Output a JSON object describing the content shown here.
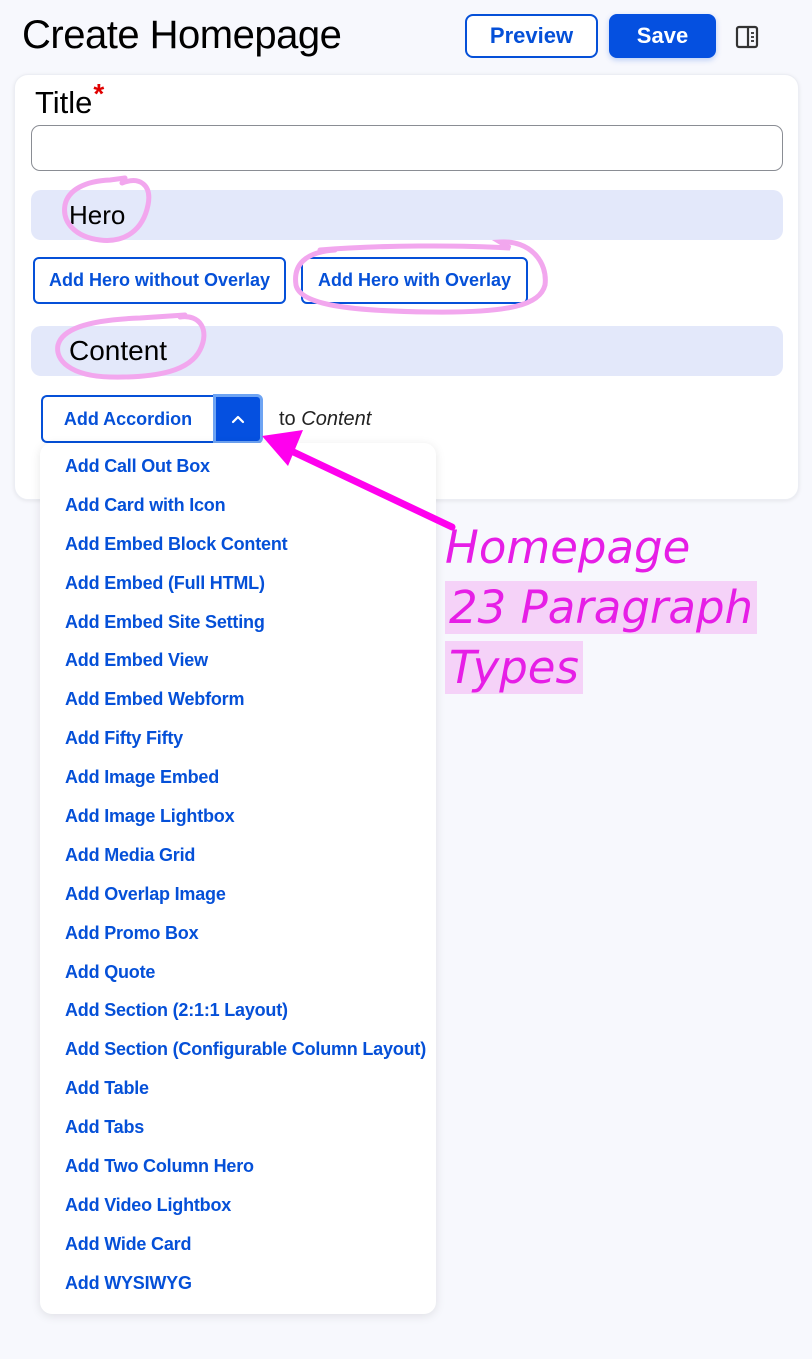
{
  "header": {
    "title": "Create Homepage",
    "preview_label": "Preview",
    "save_label": "Save",
    "sidebar_toggle_icon": "sidebar-panel-icon"
  },
  "form": {
    "title_label": "Title",
    "required_marker": "*",
    "title_value": "",
    "title_placeholder": "",
    "sections": {
      "hero": {
        "label": "Hero",
        "buttons": [
          "Add Hero without Overlay",
          "Add Hero with Overlay"
        ]
      },
      "content": {
        "label": "Content",
        "split_button_label": "Add Accordion",
        "toggle_icon": "chevron-up-icon",
        "to_prefix": "to",
        "to_target": "Content"
      }
    }
  },
  "dropdown": {
    "items": [
      "Add Call Out Box",
      "Add Card with Icon",
      "Add Embed Block Content",
      "Add Embed (Full HTML)",
      "Add Embed Site Setting",
      "Add Embed View",
      "Add Embed Webform",
      "Add Fifty Fifty",
      "Add Image Embed",
      "Add Image Lightbox",
      "Add Media Grid",
      "Add Overlap Image",
      "Add Promo Box",
      "Add Quote",
      "Add Section (2:1:1 Layout)",
      "Add Section (Configurable Column Layout)",
      "Add Table",
      "Add Tabs",
      "Add Two Column Hero",
      "Add Video Lightbox",
      "Add Wide Card",
      "Add WYSIWYG"
    ]
  },
  "annotation": {
    "line1": "Homepage",
    "line2": "23 Paragraph",
    "line3": "Types",
    "color": "#e61ee6",
    "highlight": "#f5d2f8"
  },
  "colors": {
    "accent": "#0550e0",
    "section_bg": "#e3e8fa",
    "required": "#e00000"
  }
}
